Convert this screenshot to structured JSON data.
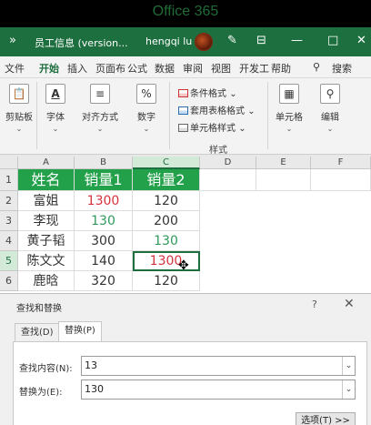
{
  "watermark": "Office 365",
  "titlebar": {
    "back_glyph": "»",
    "doc_title": "员工信息 (version...",
    "user": "hengqi lu",
    "min_glyph": "—",
    "max_glyph": "□",
    "close_glyph": "✕",
    "pen_glyph": "✎",
    "layout_glyph": "⊟"
  },
  "tabs": [
    "文件",
    "开始",
    "插入",
    "页面布",
    "公式",
    "数据",
    "审阅",
    "视图",
    "开发工",
    "帮助"
  ],
  "active_tab": "开始",
  "search_label": "搜索",
  "search_glyph": "⚲",
  "ribbon": {
    "clipboard": {
      "label": "剪贴板",
      "icon": "📋"
    },
    "font": {
      "label": "字体",
      "icon": "A"
    },
    "alignment": {
      "label": "对齐方式",
      "icon": "≡"
    },
    "number": {
      "label": "数字",
      "icon": "%"
    },
    "styles": {
      "conditional": "条件格式",
      "table": "套用表格格式",
      "cell_styles": "单元格样式",
      "group_label": "样式"
    },
    "cells": {
      "label": "单元格",
      "icon": "▦"
    },
    "editing": {
      "label": "编辑",
      "icon": "⚲"
    },
    "dropdown_glyph": "⌄"
  },
  "sheet": {
    "columns": [
      "A",
      "B",
      "C",
      "D",
      "E",
      "F"
    ],
    "rows": [
      "1",
      "2",
      "3",
      "4",
      "5",
      "6"
    ],
    "header": [
      "姓名",
      "销量1",
      "销量2"
    ],
    "data": [
      [
        "富姐",
        "1300",
        "120"
      ],
      [
        "李现",
        "130",
        "200"
      ],
      [
        "黄子韬",
        "300",
        "130"
      ],
      [
        "陈文文",
        "140",
        "1300"
      ],
      [
        "鹿晗",
        "320",
        "120"
      ]
    ],
    "colors": {
      "header_fill": "#22a04a",
      "red": "#d6333e",
      "green": "#2f9a5a"
    },
    "cursor_glyph": "✥"
  },
  "dialog": {
    "title": "查找和替换",
    "help": "?",
    "close": "✕",
    "tab_find": "查找(D)",
    "tab_replace": "替换(P)",
    "find_label": "查找内容(N):",
    "find_value": "13",
    "replace_label": "替换为(E):",
    "replace_value": "130",
    "options_button": "选项(T) >>",
    "dropdown_glyph": "⌄"
  }
}
